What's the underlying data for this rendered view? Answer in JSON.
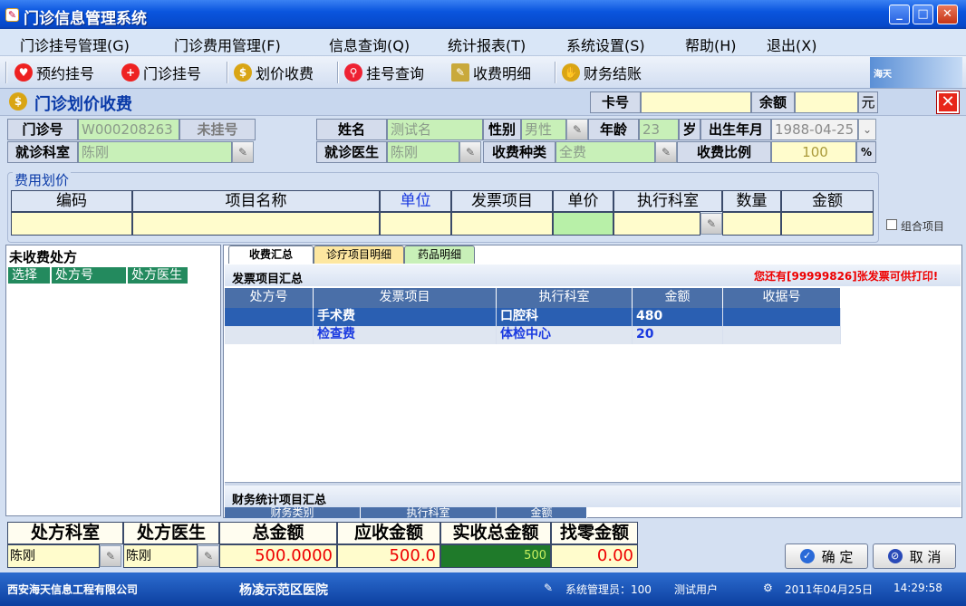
{
  "window": {
    "title": "门诊信息管理系统"
  },
  "menu": [
    "门诊挂号管理(G)",
    "门诊费用管理(F)",
    "信息查询(Q)",
    "统计报表(T)",
    "系统设置(S)",
    "帮助(H)",
    "退出(X)"
  ],
  "toolbar": {
    "items": [
      "预约挂号",
      "门诊挂号",
      "划价收费",
      "挂号查询",
      "收费明细",
      "财务结账"
    ]
  },
  "header": {
    "page_title": "门诊划价收费",
    "card_label": "卡号",
    "card_value": "",
    "balance_label": "余额",
    "balance_value": "",
    "balance_unit": "元"
  },
  "patient": {
    "clinic_no_label": "门诊号",
    "clinic_no": "W000208263",
    "unregistered": "未挂号",
    "name_label": "姓名",
    "name": "测试名",
    "gender_label": "性别",
    "gender": "男性",
    "age_label": "年龄",
    "age": "23",
    "age_unit": "岁",
    "birth_label": "出生年月",
    "birth": "1988-04-25",
    "dept_label": "就诊科室",
    "dept": "陈刚",
    "doctor_label": "就诊医生",
    "doctor": "陈刚",
    "fee_type_label": "收费种类",
    "fee_type": "全费",
    "ratio_label": "收费比例",
    "ratio": "100",
    "ratio_unit": "%"
  },
  "fee_pricing": {
    "group_label": "费用划价",
    "columns": [
      "编码",
      "项目名称",
      "单位",
      "发票项目",
      "单价",
      "执行科室",
      "数量",
      "金额"
    ],
    "combo_label": "组合项目"
  },
  "unpaid": {
    "title": "未收费处方",
    "columns": [
      "选择",
      "处方号",
      "处方医生"
    ]
  },
  "tabs": [
    "收费汇总",
    "诊疗项目明细",
    "药品明细"
  ],
  "invoice_summary": {
    "title": "发票项目汇总",
    "warning": "您还有[99999826]张发票可供打印!",
    "columns": [
      "处方号",
      "发票项目",
      "执行科室",
      "金额",
      "收据号"
    ],
    "rows": [
      {
        "rx": "",
        "item": "手术费",
        "dept": "口腔科",
        "amount": "480",
        "receipt": ""
      },
      {
        "rx": "",
        "item": "检查费",
        "dept": "体检中心",
        "amount": "20",
        "receipt": ""
      }
    ]
  },
  "finance_summary": {
    "title": "财务统计项目汇总",
    "columns": [
      "财务类别",
      "执行科室",
      "金额"
    ]
  },
  "totals": {
    "labels": [
      "处方科室",
      "处方医生",
      "总金额",
      "应收金额",
      "实收总金额",
      "找零金额"
    ],
    "rx_dept": "陈刚",
    "rx_doctor": "陈刚",
    "total": "500.0000",
    "receivable": "500.0",
    "received": "500",
    "change": "0.00"
  },
  "buttons": {
    "ok": "确 定",
    "cancel": "取 消"
  },
  "status": {
    "company": "西安海天信息工程有限公司",
    "hospital": "杨凌示范区医院",
    "admin": "系统管理员：100",
    "user": "测试用户",
    "date": "2011年04月25日",
    "time": "14:29:58"
  },
  "colors": {
    "accent": "#0648c9",
    "highlight_row": "#2a5fb2",
    "grid_header": "#4a6fa8",
    "warning": "#e00000"
  }
}
